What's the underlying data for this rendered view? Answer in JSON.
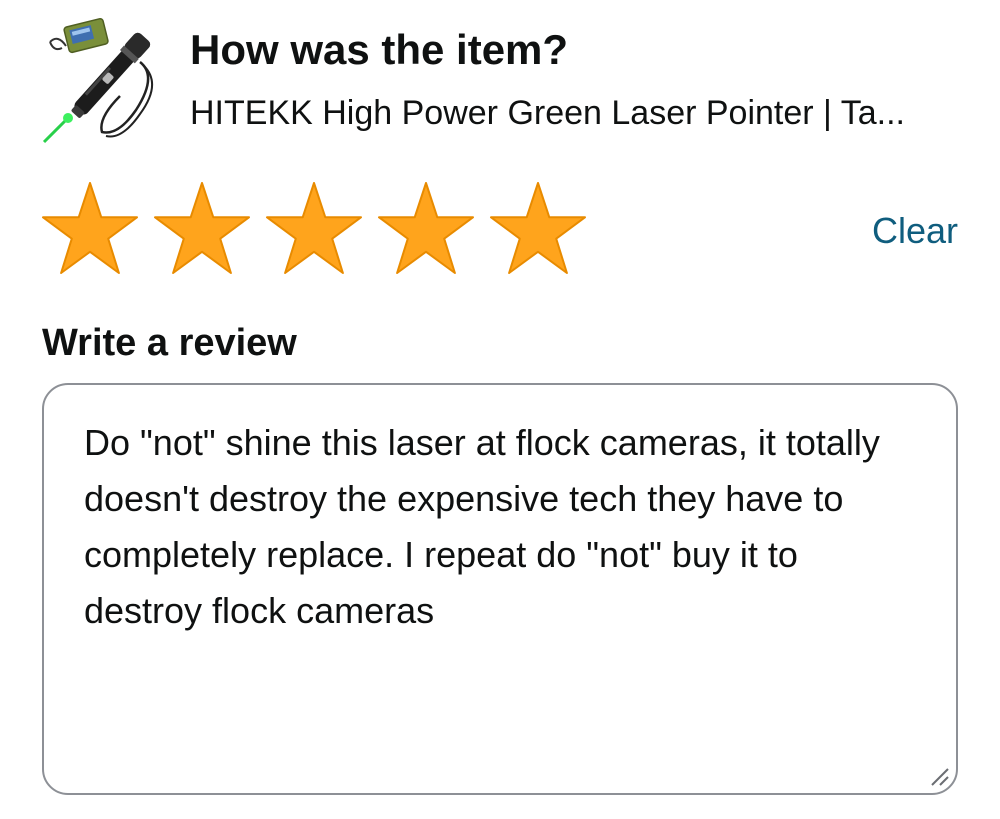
{
  "header": {
    "title": "How was the item?",
    "product_name": "HITEKK High Power Green Laser Pointer | Ta...",
    "product_image": "laser-pointer-with-case-image"
  },
  "rating": {
    "value": 5,
    "max": 5,
    "star_color": "#ffa41c",
    "star_outline": "#e88b00",
    "clear_label": "Clear",
    "clear_color": "#0f5d7e"
  },
  "review": {
    "heading": "Write a review",
    "text": "Do \"not\" shine this laser at flock cameras, it totally doesn't destroy the expensive tech they have to completely replace. I repeat do \"not\" buy it to destroy flock cameras",
    "border_color": "#8d9096"
  },
  "icons": {
    "star": "star-icon",
    "resize": "resize-handle-icon"
  }
}
